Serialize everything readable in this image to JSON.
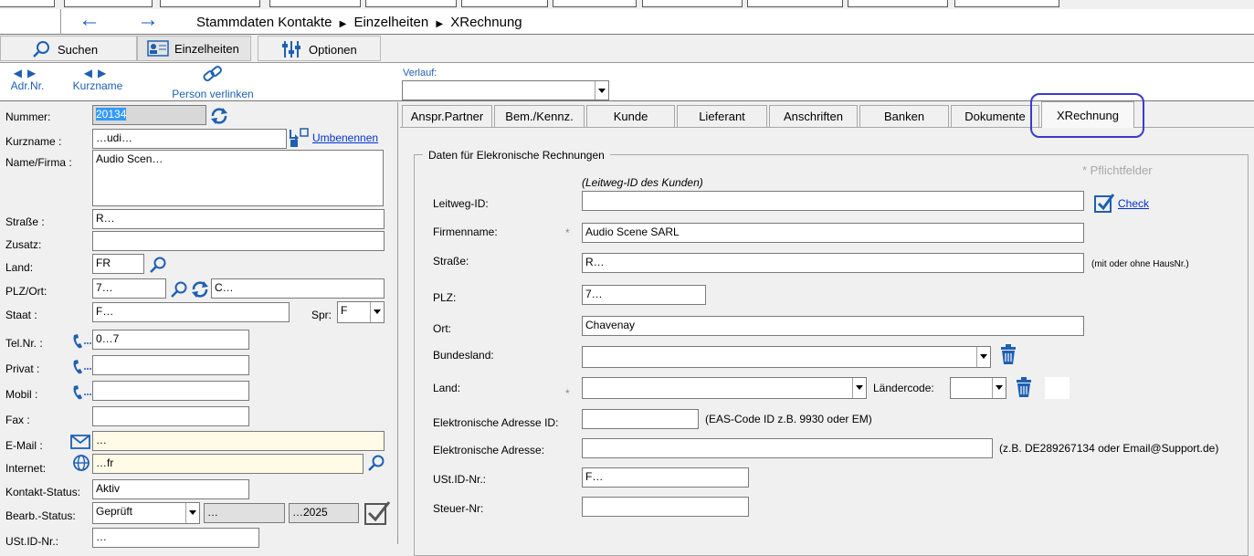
{
  "nav": {
    "back_arrow": "←",
    "forward_arrow": "→",
    "breadcrumb": [
      "Stammdaten Kontakte",
      "Einzelheiten",
      "XRechnung"
    ]
  },
  "toolbar": {
    "search_label": "Suchen",
    "details_label": "Einzelheiten",
    "options_label": "Optionen"
  },
  "subtoolbar": {
    "adrnr_label": "Adr.Nr.",
    "kurzname_label": "Kurzname",
    "link_person_label": "Person verlinken",
    "verlauf_label": "Verlauf:",
    "verlauf_value": ""
  },
  "left": {
    "nummer_label": "Nummer:",
    "nummer_value": "20134",
    "kurzname_label": "Kurzname :",
    "kurzname_value": "…udi…",
    "rename_link": "Umbenennen",
    "firma_label": "Name/Firma :",
    "firma_value": "Audio Scen…",
    "strasse_label": "Straße :",
    "strasse_value": "R…",
    "zusatz_label": "Zusatz:",
    "zusatz_value": "",
    "land_label": "Land:",
    "land_value": "FR",
    "plzort_label": "PLZ/Ort:",
    "plz_value": "7…",
    "ort_value": "C…",
    "staat_label": "Staat :",
    "staat_value": "F…",
    "spr_label": "Spr:",
    "spr_value": "F",
    "tel_label": "Tel.Nr. :",
    "tel_value": "0…7",
    "privat_label": "Privat :",
    "privat_value": "",
    "mobil_label": "Mobil :",
    "mobil_value": "",
    "fax_label": "Fax :",
    "fax_value": "",
    "email_label": "E-Mail :",
    "email_value": "…",
    "internet_label": "Internet:",
    "internet_value": "…fr",
    "kontakt_label": "Kontakt-Status:",
    "kontakt_value": "Aktiv",
    "bearb_label": "Bearb.-Status:",
    "bearb_value": "Geprüft",
    "bearb_user": "…",
    "bearb_date": "…2025",
    "ustid_label": "USt.ID-Nr.:",
    "ustid_value": "…"
  },
  "tabs": [
    {
      "label": "Anspr.Partner"
    },
    {
      "label": "Bem./Kennz."
    },
    {
      "label": "Kunde"
    },
    {
      "label": "Lieferant"
    },
    {
      "label": "Anschriften"
    },
    {
      "label": "Banken"
    },
    {
      "label": "Dokumente"
    },
    {
      "label": "XRechnung"
    }
  ],
  "xrechnung": {
    "group_title": "Daten für Elekronische Rechnungen",
    "required_note": "* Pflichtfelder",
    "leitweg_hint": "(Leitweg-ID des Kunden)",
    "leitweg_label": "Leitweg-ID:",
    "leitweg_value": "",
    "check_label": "Check",
    "firmenname_label": "Firmenname:",
    "firmenname_value": "Audio Scene SARL",
    "strasse_label": "Straße:",
    "strasse_value": "R…",
    "strasse_hint": "(mit oder ohne HausNr.)",
    "plz_label": "PLZ:",
    "plz_value": "7…",
    "ort_label": "Ort:",
    "ort_value": "Chavenay",
    "bundesland_label": "Bundesland:",
    "bundesland_value": "",
    "land_label": "Land:",
    "land_value": "",
    "laendercode_label": "Ländercode:",
    "laendercode_value": "",
    "eadr_id_label": "Elektronische Adresse ID:",
    "eadr_id_value": "",
    "eadr_id_hint": "(EAS-Code ID z.B. 9930 oder EM)",
    "eadr_label": "Elektronische Adresse:",
    "eadr_value": "",
    "eadr_hint": "(z.B. DE289267134 oder Email@Support.de)",
    "ustid_label": "USt.ID-Nr.:",
    "ustid_value": "F…",
    "steuer_label": "Steuer-Nr:",
    "steuer_value": "",
    "star": "*"
  },
  "colors": {
    "highlight": "#3399ff",
    "accent": "#1e5fb3",
    "annotation": "#3a3acb"
  }
}
